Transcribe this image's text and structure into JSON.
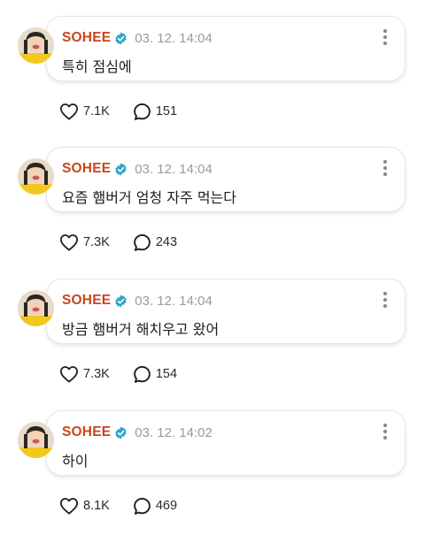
{
  "posts": [
    {
      "author": "SOHEE",
      "date": "03. 12. 14:04",
      "message": "특히 점심에",
      "likes": "7.1K",
      "comments": "151"
    },
    {
      "author": "SOHEE",
      "date": "03. 12. 14:04",
      "message": "요즘 햄버거 엄청 자주 먹는다",
      "likes": "7.3K",
      "comments": "243"
    },
    {
      "author": "SOHEE",
      "date": "03. 12. 14:04",
      "message": "방금 햄버거 해치우고 왔어",
      "likes": "7.3K",
      "comments": "154"
    },
    {
      "author": "SOHEE",
      "date": "03. 12. 14:02",
      "message": "하이",
      "likes": "8.1K",
      "comments": "469"
    }
  ],
  "icons": {
    "verified": "verified-badge-icon",
    "more": "more-vertical-icon",
    "like": "heart-icon",
    "comment": "comment-bubble-icon"
  },
  "colors": {
    "author": "#c8461e",
    "verified": "#2ea8c9",
    "date": "#9a9a9a"
  }
}
